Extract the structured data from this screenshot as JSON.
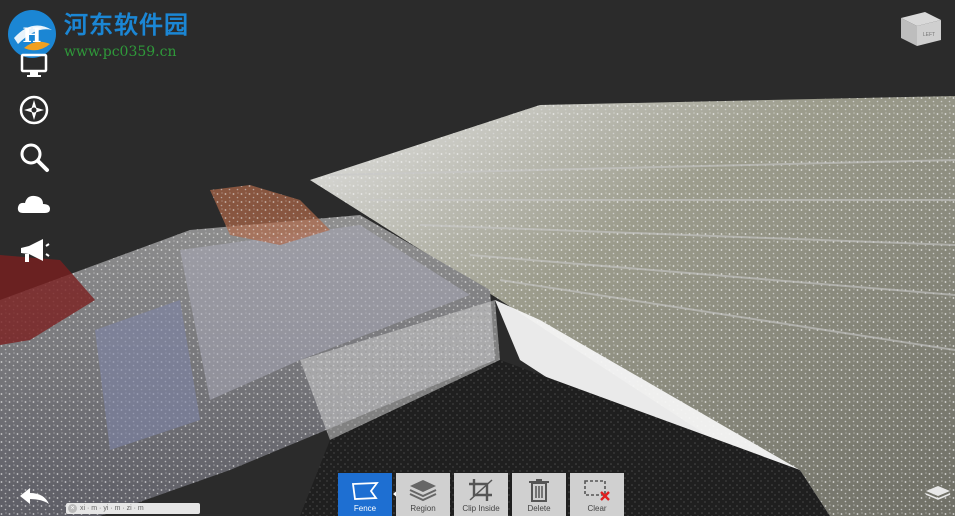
{
  "watermark": {
    "title": "河东软件园",
    "url": "www.pc0359.cn"
  },
  "viewcube": {
    "face_label": "LEFT"
  },
  "left_toolbar": {
    "items": [
      {
        "name": "monitor-icon"
      },
      {
        "name": "compass-icon"
      },
      {
        "name": "search-icon"
      },
      {
        "name": "cloud-icon"
      },
      {
        "name": "megaphone-icon"
      }
    ]
  },
  "bottom_toolbar": {
    "items": [
      {
        "label": "Fence",
        "icon": "fence-icon",
        "active": true
      },
      {
        "label": "Region",
        "icon": "layers-icon",
        "active": false
      },
      {
        "label": "Clip Inside",
        "icon": "crop-icon",
        "active": false
      },
      {
        "label": "Delete",
        "icon": "trash-icon",
        "active": false
      },
      {
        "label": "Clear",
        "icon": "clear-selection-icon",
        "active": false
      }
    ]
  },
  "scale": {
    "text": "xi · m · yi · m · zi · m"
  },
  "colors": {
    "active": "#1e6fd2",
    "button_bg": "#d0d0d0",
    "background": "#2b2b2b"
  }
}
